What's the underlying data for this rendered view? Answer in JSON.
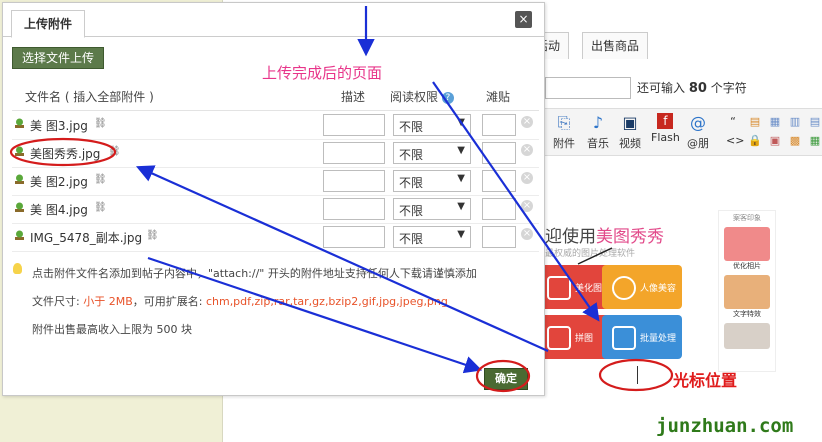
{
  "background": {
    "tabs": [
      "活动",
      "出售商品"
    ],
    "remain": {
      "prefix": "还可输入",
      "count": "80",
      "suffix": "个字符"
    },
    "toolbar": [
      {
        "label": "附件",
        "icon": "attachment-icon"
      },
      {
        "label": "音乐",
        "icon": "music-icon"
      },
      {
        "label": "视频",
        "icon": "video-icon"
      },
      {
        "label": "Flash",
        "icon": "flash-icon"
      },
      {
        "label": "@朋",
        "icon": "at-icon"
      }
    ],
    "promo": {
      "title_a": "迎使用",
      "title_b": "美图秀秀",
      "sub": "最权威的图片处理软件"
    },
    "tiles": [
      "美化图片",
      "人像美容",
      "拼图",
      "批量处理"
    ],
    "side_panel": {
      "title": "案客印象",
      "labels": [
        "优化相片",
        "文字特效"
      ]
    }
  },
  "dialog": {
    "tab": "上传附件",
    "close": "×",
    "upload_button": "选择文件上传",
    "upload_done": "上传完成后的页面",
    "headers": {
      "file": "文件名 ( 插入全部附件 )",
      "desc": "描述",
      "perm": "阅读权限",
      "price": "滩贴"
    },
    "files": [
      {
        "name": "美 图3.jpg",
        "perm": "不限"
      },
      {
        "name": "美图秀秀.jpg",
        "perm": "不限"
      },
      {
        "name": "美 图2.jpg",
        "perm": "不限"
      },
      {
        "name": "美 图4.jpg",
        "perm": "不限"
      },
      {
        "name": "IMG_5478_副本.jpg",
        "perm": "不限"
      }
    ],
    "notes": {
      "line1": "点击附件文件名添加到帖子内容中，\"attach://\" 开头的附件地址支持任何人下载请谨慎添加",
      "size_label": "文件尺寸: ",
      "size_value": "小于 2MB",
      "ext_label": "，可用扩展名: ",
      "ext_value": "chm,pdf,zip,rar,tar,gz,bzip2,gif,jpg,jpeg,png",
      "line3": "附件出售最高收入上限为 500 块"
    },
    "confirm": "确定"
  },
  "annotations": {
    "cursor_label": "光标位置",
    "watermark": "junzhuan.com"
  },
  "colors": {
    "annotation_arrow": "#1a2fd6",
    "annotation_circle": "#d41c1c",
    "accent_pink": "#e8358a",
    "button_green": "#4a6a32"
  }
}
